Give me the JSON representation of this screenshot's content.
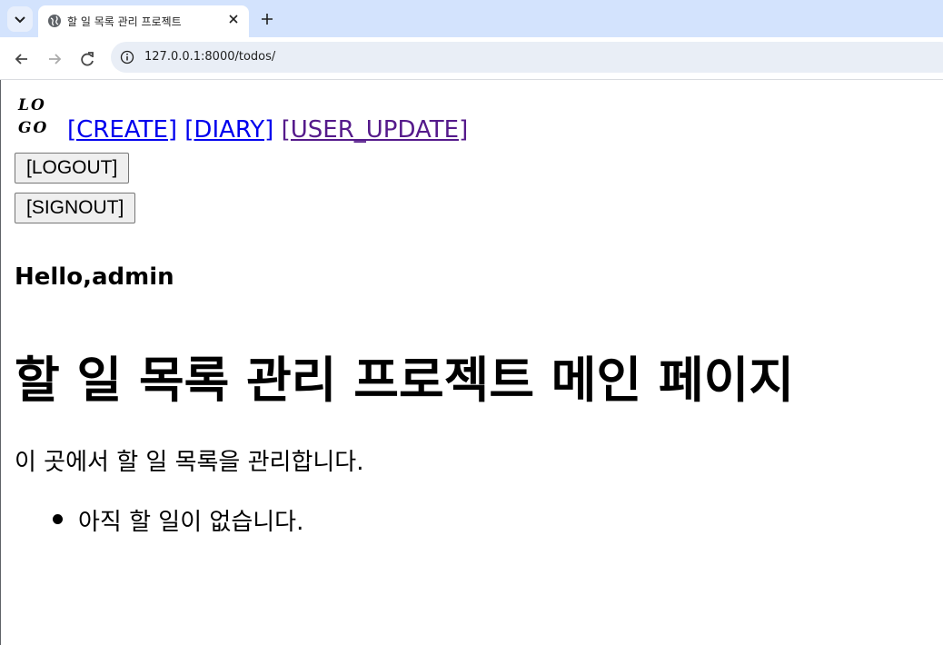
{
  "browser": {
    "tab_title": "할 일 목록 관리 프로젝트",
    "url": "127.0.0.1:8000/todos/"
  },
  "nav": {
    "logo_line1": "LO",
    "logo_line2": "GO",
    "links": [
      "[CREATE]",
      "[DIARY]",
      "[USER_UPDATE]"
    ]
  },
  "buttons": {
    "logout": "[LOGOUT]",
    "signout": "[SIGNOUT]"
  },
  "greeting": "Hello,admin",
  "page_title": "할 일 목록 관리 프로젝트 메인 페이지",
  "description": "이 곳에서 할 일 목록을 관리합니다.",
  "todos": [
    "아직 할 일이 없습니다."
  ],
  "colors": {
    "tabstrip": "#d3e3fd",
    "link": "#0000ee",
    "visited_link": "#551a8b"
  }
}
